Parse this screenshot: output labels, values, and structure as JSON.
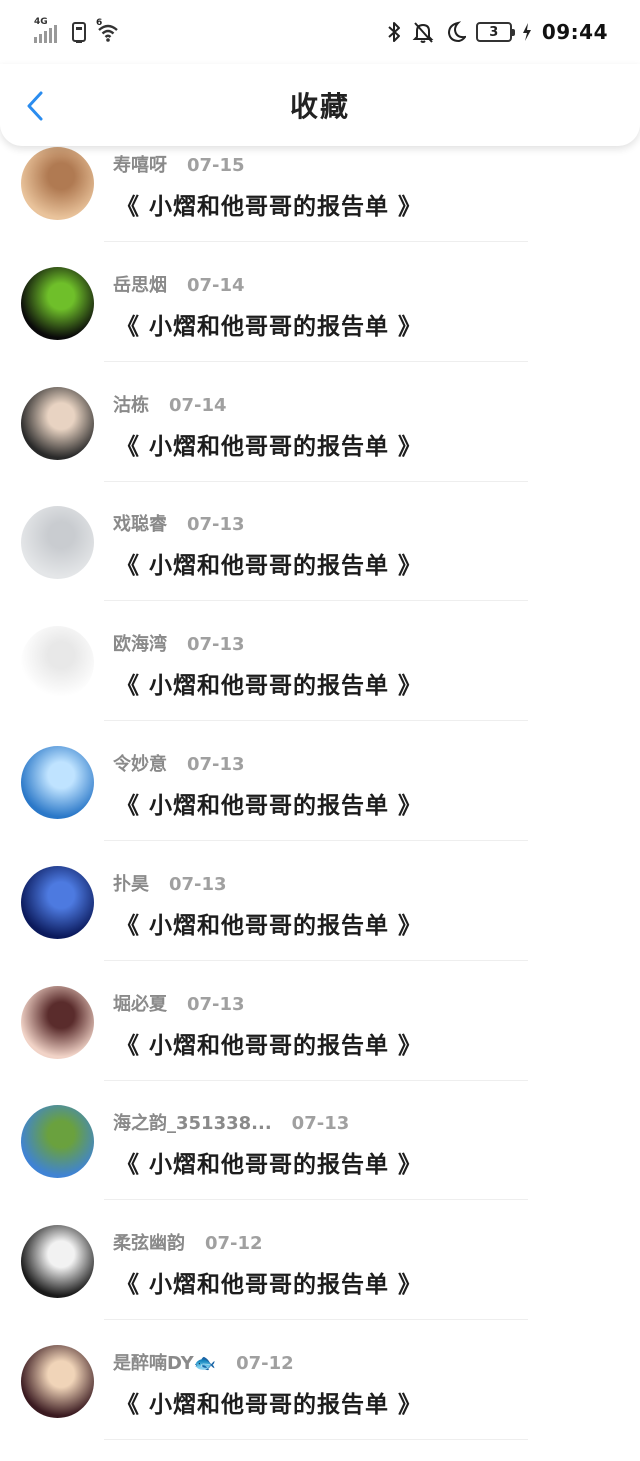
{
  "status": {
    "network_tag": "4G",
    "wifi_tag": "6",
    "battery_level": "3",
    "time": "09:44"
  },
  "header": {
    "title": "收藏"
  },
  "items": [
    {
      "name": "寿嘻呀",
      "date": "07-15",
      "content": "《 小熠和他哥哥的报告单 》",
      "avatar_colors": [
        "#e9c39b",
        "#b07a52"
      ]
    },
    {
      "name": "岳思烟",
      "date": "07-14",
      "content": "《 小熠和他哥哥的报告单 》",
      "avatar_colors": [
        "#0a0a0a",
        "#6fbf2a"
      ]
    },
    {
      "name": "沽栋",
      "date": "07-14",
      "content": "《 小熠和他哥哥的报告单 》",
      "avatar_colors": [
        "#2a2a2a",
        "#e8d3c2"
      ]
    },
    {
      "name": "戏聪睿",
      "date": "07-13",
      "content": "《 小熠和他哥哥的报告单 》",
      "avatar_colors": [
        "#e4e6e8",
        "#c9ccd0"
      ]
    },
    {
      "name": "欧海湾",
      "date": "07-13",
      "content": "《 小熠和他哥哥的报告单 》",
      "avatar_colors": [
        "#ffffff",
        "#e8e8e8"
      ]
    },
    {
      "name": "令妙意",
      "date": "07-13",
      "content": "《 小熠和他哥哥的报告单 》",
      "avatar_colors": [
        "#2b78c8",
        "#bfe3ff"
      ]
    },
    {
      "name": "扑昊",
      "date": "07-13",
      "content": "《 小熠和他哥哥的报告单 》",
      "avatar_colors": [
        "#0b1a5c",
        "#4d7ae0"
      ]
    },
    {
      "name": "堀必夏",
      "date": "07-13",
      "content": "《 小熠和他哥哥的报告单 》",
      "avatar_colors": [
        "#f1d3c7",
        "#5a2c2c"
      ]
    },
    {
      "name": "海之韵_351338...",
      "date": "07-13",
      "content": "《 小熠和他哥哥的报告单 》",
      "avatar_colors": [
        "#3f83d4",
        "#6aa13e"
      ]
    },
    {
      "name": "柔弦幽韵",
      "date": "07-12",
      "content": "《 小熠和他哥哥的报告单 》",
      "avatar_colors": [
        "#1a1a1a",
        "#f2f2f2"
      ]
    },
    {
      "name": "是醉喃DY🐟",
      "date": "07-12",
      "content": "《 小熠和他哥哥的报告单 》",
      "avatar_colors": [
        "#3a1a20",
        "#f0d4b8"
      ]
    }
  ]
}
